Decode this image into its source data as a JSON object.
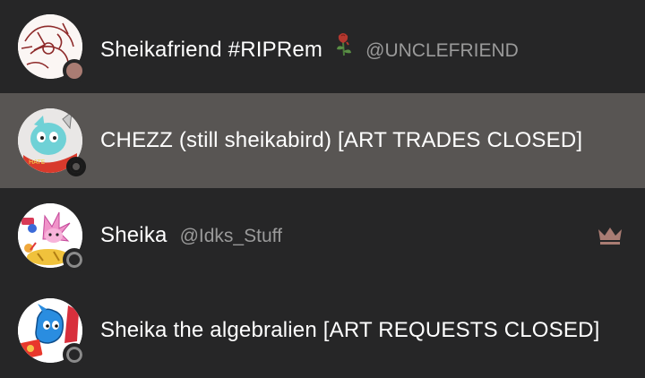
{
  "members": [
    {
      "name": "Sheikafriend #RIPRem",
      "emoji": "wilted-rose-icon",
      "handle": "@UNCLEFRIEND",
      "status": "away",
      "selected": false
    },
    {
      "name": "CHEZZ (still sheikabird) [ART TRADES CLOSED]",
      "handle": "",
      "status": "offline",
      "selected": true
    },
    {
      "name": "Sheika",
      "handle": "@Idks_Stuff",
      "status": "offline",
      "badge": "crown-icon",
      "selected": false
    },
    {
      "name": "Sheika the algebralien [ART REQUESTS CLOSED]",
      "handle": "",
      "status": "offline",
      "selected": false
    }
  ],
  "colors": {
    "background": "#262627",
    "selected_row": "#585553",
    "away": "#a97c73",
    "crown": "#a97c73"
  }
}
